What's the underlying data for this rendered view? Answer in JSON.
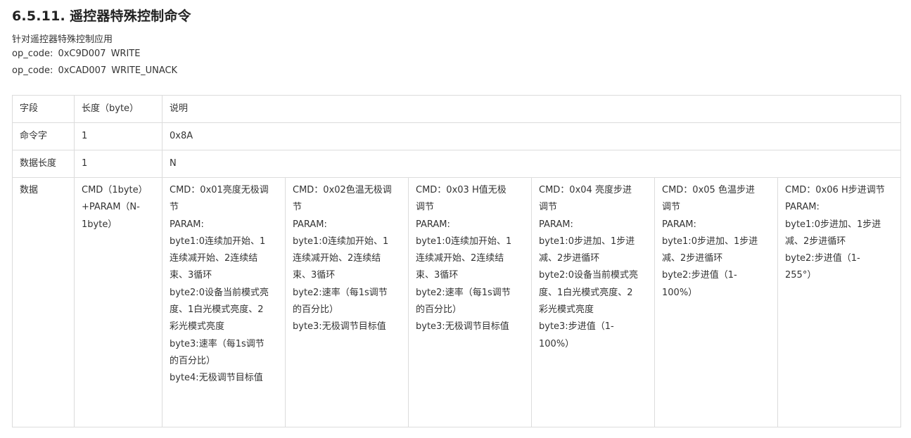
{
  "section": {
    "number": "6.5.11.",
    "title": "遥控器特殊控制命令"
  },
  "description": "针对遥控器特殊控制应用",
  "opcodes": [
    {
      "label": "op_code:",
      "code": "0xC9D007",
      "name": "WRITE"
    },
    {
      "label": "op_code:",
      "code": "0xCAD007",
      "name": "WRITE_UNACK"
    }
  ],
  "table": {
    "header": {
      "field": "字段",
      "length": "长度（byte）",
      "desc": "说明"
    },
    "rows": [
      {
        "field": "命令字",
        "length": "1",
        "desc": "0x8A"
      },
      {
        "field": "数据长度",
        "length": "1",
        "desc": "N"
      }
    ],
    "data_row": {
      "field": "数据",
      "length_lines": [
        "CMD（1byte）",
        "+PARAM（N-",
        "1byte）"
      ],
      "cmds": [
        {
          "lines": [
            "CMD：0x01亮度无极调",
            "节",
            "PARAM:",
            "byte1:0连续加开始、1",
            "连续减开始、2连续结",
            "束、3循环",
            "byte2:0设备当前模式亮",
            "度、1白光模式亮度、2",
            "彩光模式亮度",
            "byte3:速率（每1s调节",
            "的百分比）",
            "byte4:无极调节目标值"
          ]
        },
        {
          "lines": [
            "CMD：0x02色温无极调",
            "节",
            "PARAM:",
            "byte1:0连续加开始、1",
            "连续减开始、2连续结",
            "束、3循环",
            "byte2:速率（每1s调节",
            "的百分比）",
            "byte3:无极调节目标值"
          ]
        },
        {
          "lines": [
            "CMD：0x03  H值无极",
            "调节",
            "PARAM:",
            "byte1:0连续加开始、1",
            "连续减开始、2连续结",
            "束、3循环",
            "byte2:速率（每1s调节",
            "的百分比）",
            "byte3:无极调节目标值"
          ]
        },
        {
          "lines": [
            "CMD：0x04 亮度步进",
            "调节",
            "PARAM:",
            "byte1:0步进加、1步进",
            "减、2步进循环",
            "byte2:0设备当前模式亮",
            "度、1白光模式亮度、2",
            "彩光模式亮度",
            "byte3:步进值（1-",
            "100%）"
          ]
        },
        {
          "lines": [
            "CMD：0x05 色温步进",
            "调节",
            "PARAM:",
            "byte1:0步进加、1步进",
            "减、2步进循环",
            "byte2:步进值（1-",
            "100%）"
          ]
        },
        {
          "lines": [
            "CMD：0x06 H步进调节",
            "PARAM:",
            "byte1:0步进加、1步进",
            "减、2步进循环",
            "byte2:步进值（1-",
            "255°）"
          ]
        }
      ]
    }
  }
}
